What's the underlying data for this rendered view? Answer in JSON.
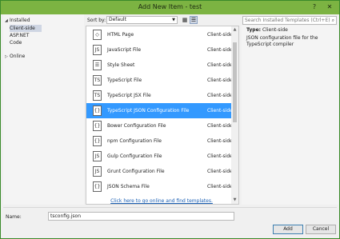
{
  "window": {
    "title": "Add New Item - test",
    "help_glyph": "?",
    "close_glyph": "✕"
  },
  "tree": {
    "installed": "Installed",
    "children": [
      "Client-side",
      "ASP.NET",
      "Code"
    ],
    "online": "Online"
  },
  "toolbar": {
    "sort_label": "Sort by:",
    "sort_value": "Default"
  },
  "search": {
    "placeholder": "Search Installed Templates (Ctrl+E)"
  },
  "items": [
    {
      "name": "HTML Page",
      "category": "Client-side",
      "icon": "html-file-icon",
      "glyph": "◇"
    },
    {
      "name": "JavaScript File",
      "category": "Client-side",
      "icon": "javascript-file-icon",
      "glyph": "JS"
    },
    {
      "name": "Style Sheet",
      "category": "Client-side",
      "icon": "stylesheet-file-icon",
      "glyph": "☰"
    },
    {
      "name": "TypeScript File",
      "category": "Client-side",
      "icon": "typescript-file-icon",
      "glyph": "TS"
    },
    {
      "name": "TypeScript JSX File",
      "category": "Client-side",
      "icon": "tsx-file-icon",
      "glyph": "TS"
    },
    {
      "name": "TypeScript JSON Configuration File",
      "category": "Client-side",
      "icon": "json-config-file-icon",
      "glyph": "{}"
    },
    {
      "name": "Bower Configuration File",
      "category": "Client-side",
      "icon": "bower-config-file-icon",
      "glyph": "{}"
    },
    {
      "name": "npm Configuration File",
      "category": "Client-side",
      "icon": "npm-config-file-icon",
      "glyph": "{}"
    },
    {
      "name": "Gulp Configuration File",
      "category": "Client-side",
      "icon": "gulp-config-file-icon",
      "glyph": "JS"
    },
    {
      "name": "Grunt Configuration File",
      "category": "Client-side",
      "icon": "grunt-config-file-icon",
      "glyph": "JS"
    },
    {
      "name": "JSON Schema File",
      "category": "Client-side",
      "icon": "json-schema-file-icon",
      "glyph": "{}"
    }
  ],
  "online_link": "Click here to go online and find templates.",
  "details": {
    "type_label": "Type:",
    "type_value": "Client-side",
    "description": "JSON configuration file for the TypeScript compiler"
  },
  "name_field": {
    "label": "Name:",
    "value": "tsconfig.json"
  },
  "buttons": {
    "add": "Add",
    "cancel": "Cancel"
  },
  "colors": {
    "title_bar": "#7cb342",
    "selection": "#3399ff",
    "link": "#1a5fb4"
  }
}
